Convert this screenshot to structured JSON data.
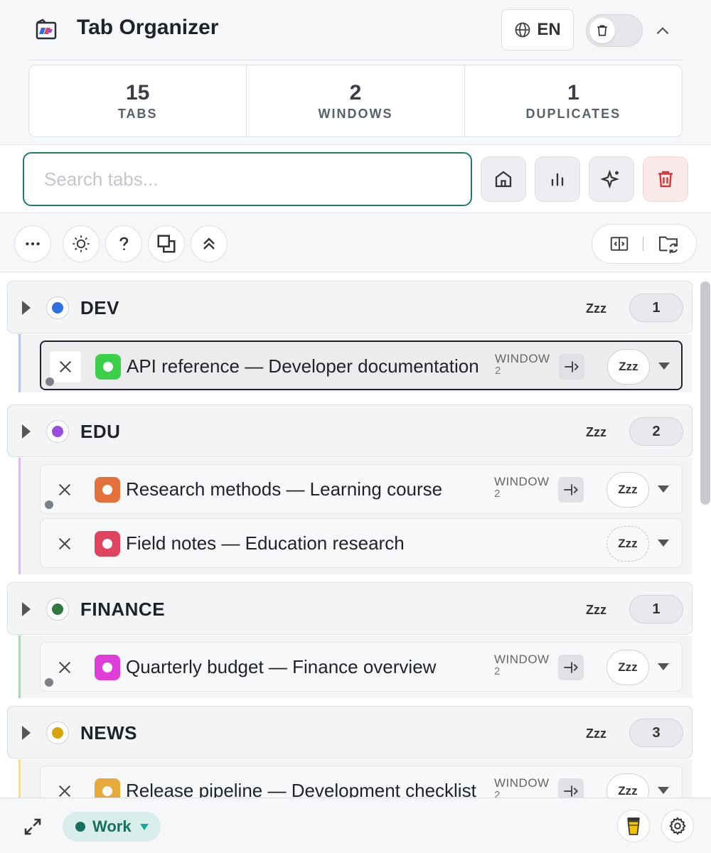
{
  "app": {
    "title": "Tab Organizer",
    "language": "EN"
  },
  "stats": [
    {
      "value": "15",
      "label": "TABS"
    },
    {
      "value": "2",
      "label": "WINDOWS"
    },
    {
      "value": "1",
      "label": "DUPLICATES"
    }
  ],
  "search": {
    "placeholder": "Search tabs..."
  },
  "groups": [
    {
      "name": "DEV",
      "color": "#2f6fe0",
      "bar_color": "#b7c8ee",
      "count": "1",
      "snooze": "Zzz",
      "tabs": [
        {
          "title": "API reference — Developer documentation",
          "window_label": "WINDOW",
          "window_num": "2",
          "snooze": "Zzz",
          "favicon_color": "#3cd04a",
          "active": true
        }
      ]
    },
    {
      "name": "EDU",
      "color": "#9a4be0",
      "bar_color": "#d7bdf2",
      "count": "2",
      "snooze": "Zzz",
      "tabs": [
        {
          "title": "Research methods — Learning course",
          "window_label": "WINDOW",
          "window_num": "2",
          "snooze": "Zzz",
          "favicon_color": "#e4703a"
        },
        {
          "title": "Field notes — Education research",
          "snooze": "Zzz",
          "favicon_color": "#e0445e"
        }
      ]
    },
    {
      "name": "FINANCE",
      "color": "#2f7a3c",
      "bar_color": "#b3d3b7",
      "count": "1",
      "snooze": "Zzz",
      "tabs": [
        {
          "title": "Quarterly budget — Finance overview",
          "window_label": "WINDOW",
          "window_num": "2",
          "snooze": "Zzz",
          "favicon_color": "#e03ed8"
        }
      ]
    },
    {
      "name": "NEWS",
      "color": "#d9a30a",
      "bar_color": "#f2dca0",
      "count": "3",
      "snooze": "Zzz",
      "tabs": [
        {
          "title": "Release pipeline — Development checklist",
          "window_label": "WINDOW",
          "window_num": "2",
          "snooze": "Zzz",
          "favicon_color": "#e6a93a"
        }
      ]
    }
  ],
  "footer": {
    "profile": "Work",
    "profile_color": "#17705f"
  },
  "icons": {
    "header": [
      "logo-icon",
      "globe-icon",
      "trash-icon",
      "chevron-up-icon"
    ],
    "search_actions": [
      "home-icon",
      "bar-chart-icon",
      "sparkles-icon",
      "trash-icon"
    ],
    "toolbar": [
      "more-icon",
      "sun-icon",
      "help-icon",
      "duplicate-icon",
      "collapse-all-icon",
      "split-view-icon",
      "folder-sync-icon"
    ],
    "footer": [
      "expand-icon",
      "coffee-cup-icon",
      "settings-icon"
    ]
  }
}
